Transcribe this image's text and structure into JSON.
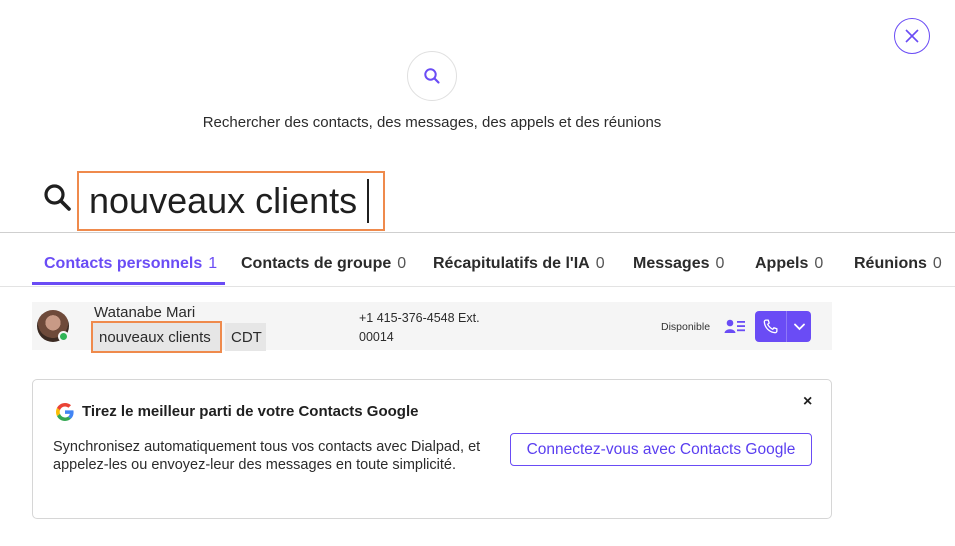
{
  "header": {
    "subtitle": "Rechercher des contacts, des messages, des appels et des réunions"
  },
  "search": {
    "value": "nouveaux clients"
  },
  "tabs": [
    {
      "label": "Contacts personnels",
      "count": "1"
    },
    {
      "label": "Contacts de groupe",
      "count": "0"
    },
    {
      "label": "Récapitulatifs de l'IA",
      "count": "0"
    },
    {
      "label": "Messages",
      "count": "0"
    },
    {
      "label": "Appels",
      "count": "0"
    },
    {
      "label": "Réunions",
      "count": "0"
    }
  ],
  "results": [
    {
      "name": "Watanabe Mari",
      "tags": [
        "nouveaux clients",
        "CDT"
      ],
      "phone_line1": "+1 415-376-4548 Ext.",
      "phone_line2": "00014",
      "status": "Disponible"
    }
  ],
  "promo": {
    "title": "Tirez le meilleur parti de votre Contacts Google",
    "body": "Synchronisez automatiquement tous vos contacts avec Dialpad, et appelez-les ou envoyez-leur des messages en toute simplicité.",
    "button_label": "Connectez-vous avec Contacts Google",
    "close_label": "×"
  },
  "colors": {
    "accent": "#6a4cf5",
    "highlight": "#ef8a4c",
    "presence": "#2fb455"
  },
  "icons": {
    "close": "close-icon",
    "search": "search-icon",
    "profile": "contact-card-icon",
    "phone": "phone-icon",
    "dropdown": "chevron-down-icon",
    "google": "google-logo"
  }
}
